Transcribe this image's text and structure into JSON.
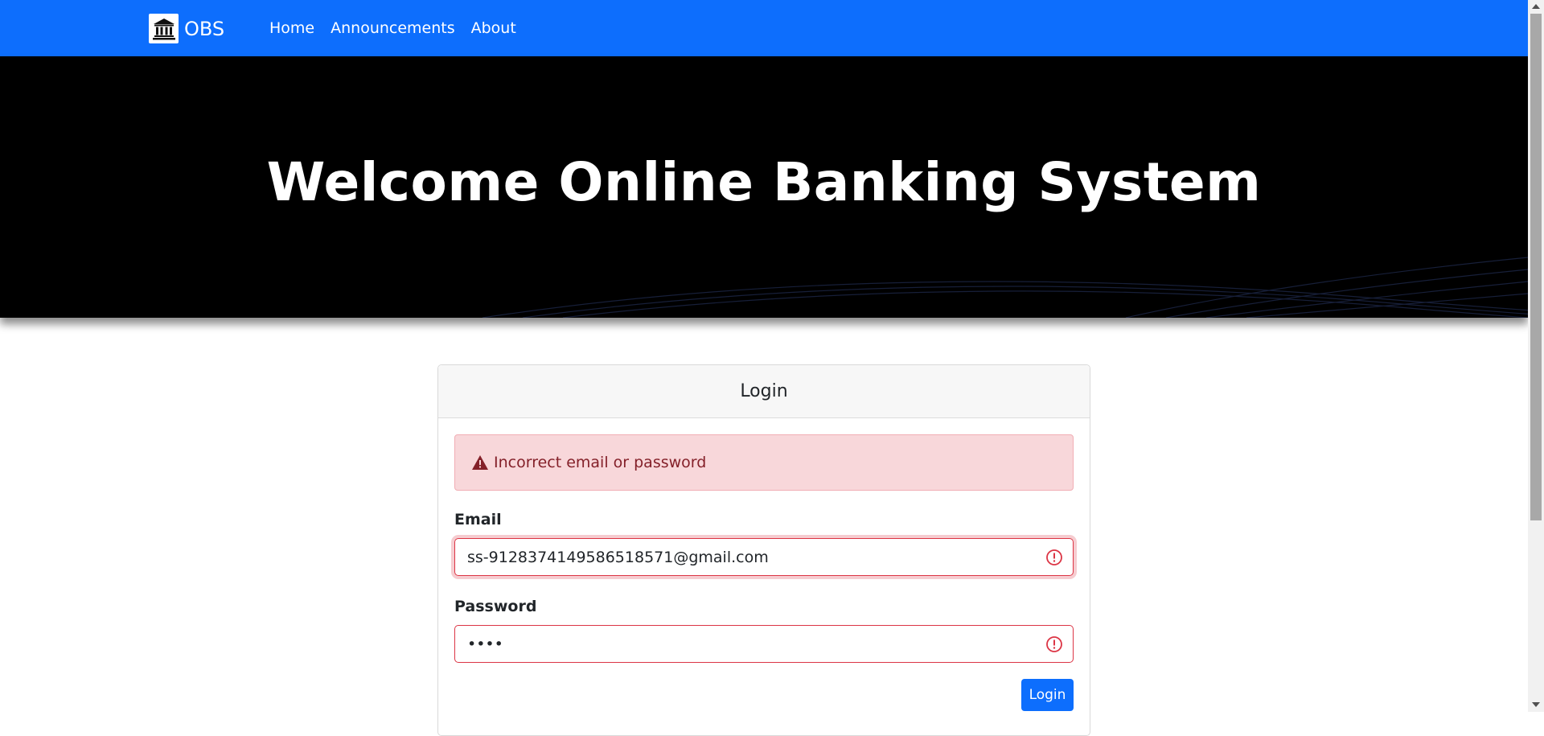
{
  "navbar": {
    "brand": "OBS",
    "links": [
      "Home",
      "Announcements",
      "About"
    ]
  },
  "hero": {
    "title": "Welcome Online Banking System"
  },
  "login_card": {
    "header": "Login",
    "alert": "Incorrect email or password",
    "email_label": "Email",
    "email_value": "ss-9128374149586518571@gmail.com",
    "password_label": "Password",
    "password_value": "abcd",
    "submit_label": "Login"
  },
  "colors": {
    "primary": "#0d6efd",
    "danger": "#dc3545",
    "alert_bg": "#f8d7da",
    "alert_text": "#842029",
    "hero_bg": "#000000"
  },
  "icons": {
    "brand": "bank-icon",
    "alert": "warning-triangle-icon",
    "invalid": "exclamation-circle-icon"
  }
}
